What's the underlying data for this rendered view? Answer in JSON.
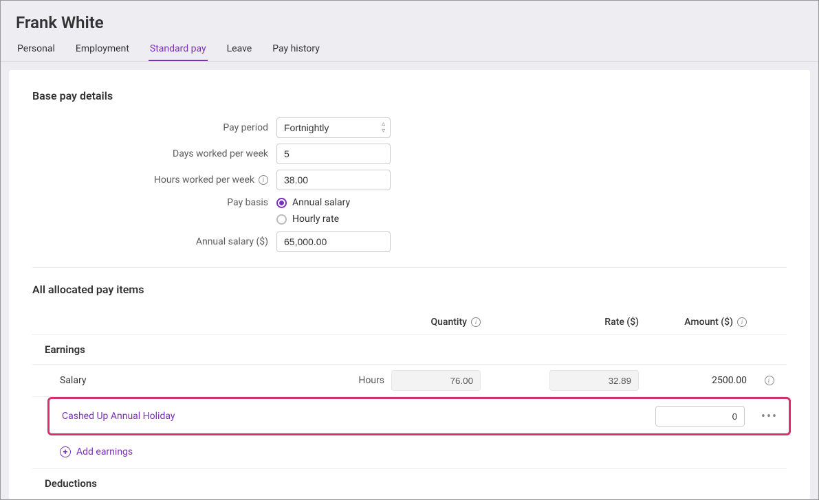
{
  "header": {
    "title": "Frank White"
  },
  "tabs": [
    {
      "id": "personal",
      "label": "Personal",
      "active": false
    },
    {
      "id": "employment",
      "label": "Employment",
      "active": false
    },
    {
      "id": "standard-pay",
      "label": "Standard pay",
      "active": true
    },
    {
      "id": "leave",
      "label": "Leave",
      "active": false
    },
    {
      "id": "pay-history",
      "label": "Pay history",
      "active": false
    }
  ],
  "base_pay": {
    "section_title": "Base pay details",
    "pay_period": {
      "label": "Pay period",
      "value": "Fortnightly"
    },
    "days_per_week": {
      "label": "Days worked per week",
      "value": "5"
    },
    "hours_per_week": {
      "label": "Hours worked per week",
      "value": "38.00"
    },
    "pay_basis": {
      "label": "Pay basis",
      "options": {
        "annual": "Annual salary",
        "hourly": "Hourly rate"
      },
      "selected": "annual"
    },
    "annual_salary": {
      "label": "Annual salary ($)",
      "value": "65,000.00"
    }
  },
  "allocated": {
    "section_title": "All allocated pay items",
    "columns": {
      "quantity": "Quantity",
      "rate": "Rate ($)",
      "amount": "Amount ($)"
    },
    "groups": {
      "earnings": {
        "label": "Earnings",
        "rows": {
          "salary": {
            "name": "Salary",
            "unit": "Hours",
            "quantity": "76.00",
            "rate": "32.89",
            "amount": "2500.00"
          },
          "cashed_up": {
            "name": "Cashed Up Annual Holiday",
            "amount": "0"
          }
        },
        "add_label": "Add earnings"
      },
      "deductions": {
        "label": "Deductions"
      }
    }
  }
}
